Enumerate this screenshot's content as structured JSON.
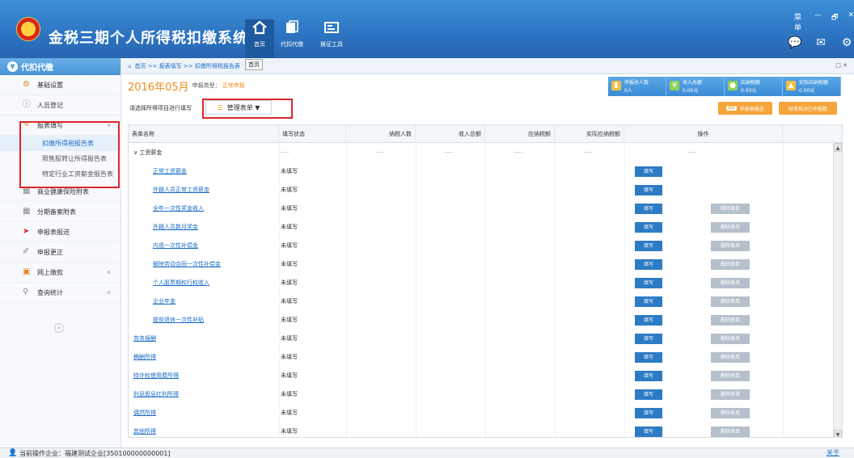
{
  "header": {
    "app_title": "金税三期个人所得税扣缴系统",
    "nav": [
      {
        "label": "首页",
        "icon": "home-icon"
      },
      {
        "label": "代扣代缴",
        "icon": "proxy-icon"
      },
      {
        "label": "换证工具",
        "icon": "cert-tool-icon"
      }
    ],
    "tooltip": "首页",
    "window_menu": "菜单",
    "window_min": "—",
    "window_restore": "🗗",
    "window_close": "✕",
    "right_icons": [
      "chat-icon",
      "mail-icon",
      "settings-icon"
    ]
  },
  "sidebar": {
    "title": "代扣代缴",
    "items": [
      {
        "label": "基础设置",
        "icon": "gear-icon",
        "glyph": "⚙"
      },
      {
        "label": "人员登记",
        "icon": "user-icon",
        "glyph": "ⓘ"
      },
      {
        "label": "报表填写",
        "icon": "edit-icon",
        "glyph": "✎",
        "expanded": true,
        "children": [
          "扣缴所得税报告表",
          "限售股转让所得报告表",
          "特定行业工资薪金报告表"
        ]
      },
      {
        "label": "商业健康保险附表",
        "icon": "grid-icon",
        "glyph": "▦"
      },
      {
        "label": "分期备案附表",
        "icon": "grid-icon",
        "glyph": "▦"
      },
      {
        "label": "申报表报送",
        "icon": "send-icon",
        "glyph": "➤"
      },
      {
        "label": "申报更正",
        "icon": "correct-icon",
        "glyph": "✐"
      },
      {
        "label": "网上缴款",
        "icon": "payment-icon",
        "glyph": "▣"
      },
      {
        "label": "查询统计",
        "icon": "search-icon",
        "glyph": "⚲"
      }
    ],
    "collapse_glyph": "«"
  },
  "breadcrumb": {
    "home_glyph": "⌂",
    "items": [
      "首页",
      ">>",
      "报表填写",
      ">>",
      "扣缴所得税报告表"
    ],
    "right": "□ ✕"
  },
  "period": {
    "date": "2016年05月",
    "type_label": "申报类型：",
    "type_value": "正常申报"
  },
  "stats": [
    {
      "label": "申报总人数",
      "value": "0人",
      "color": "#f0c040"
    },
    {
      "label": "收入总额",
      "value": "0.00元",
      "color": "#8fd05a"
    },
    {
      "label": "应纳税额",
      "value": "0.00元",
      "color": "#8fd05a"
    },
    {
      "label": "实际应纳税额",
      "value": "0.00元",
      "color": "#f0c040"
    }
  ],
  "toolbar": {
    "select_hint": "请选择所得项目进行填写",
    "manage_label": "管理表单 ▼",
    "manage_glyph": "☰",
    "submit_go": "GO",
    "submit_label": "申报表报送",
    "finance_label": "财务核对已申报数"
  },
  "table": {
    "headers": [
      "表单名称",
      "填写状态",
      "纳税人数",
      "收入总额",
      "应纳税额",
      "实际应纳税额",
      "操作"
    ],
    "group": {
      "name": "工资薪金",
      "dash": "----"
    },
    "fill_label": "填写",
    "delete_label": "删除表单",
    "rows": [
      {
        "name": "正常工资薪金",
        "status": "未填写",
        "indent": true,
        "delete": false
      },
      {
        "name": "外籍人员正常工资薪金",
        "status": "未填写",
        "indent": true,
        "delete": false
      },
      {
        "name": "全年一次性奖金收入",
        "status": "未填写",
        "indent": true,
        "delete": true
      },
      {
        "name": "外籍人员数月奖金",
        "status": "未填写",
        "indent": true,
        "delete": true
      },
      {
        "name": "内退一次性补偿金",
        "status": "未填写",
        "indent": true,
        "delete": true
      },
      {
        "name": "解除劳动合同一次性补偿金",
        "status": "未填写",
        "indent": true,
        "delete": true
      },
      {
        "name": "个人股票期权行权收入",
        "status": "未填写",
        "indent": true,
        "delete": true
      },
      {
        "name": "企业年金",
        "status": "未填写",
        "indent": true,
        "delete": true
      },
      {
        "name": "提前退休一次性补贴",
        "status": "未填写",
        "indent": true,
        "delete": true
      },
      {
        "name": "劳务报酬",
        "status": "未填写",
        "indent": false,
        "delete": true
      },
      {
        "name": "稿酬所得",
        "status": "未填写",
        "indent": false,
        "delete": true
      },
      {
        "name": "特许权使用费所得",
        "status": "未填写",
        "indent": false,
        "delete": true
      },
      {
        "name": "利息股息红利所得",
        "status": "未填写",
        "indent": false,
        "delete": true
      },
      {
        "name": "偶然所得",
        "status": "未填写",
        "indent": false,
        "delete": true
      },
      {
        "name": "其他所得",
        "status": "未填写",
        "indent": false,
        "delete": true
      }
    ]
  },
  "status_bar": {
    "label": "当前操作企业：福建测试企业[350100000000001]",
    "about": "关于"
  },
  "colors": {
    "header_blue": "#2d74c2",
    "accent_orange": "#f08a1e",
    "link_blue": "#1a6dc8",
    "button_blue": "#2d7bc4",
    "highlight_red": "#d8282b"
  }
}
